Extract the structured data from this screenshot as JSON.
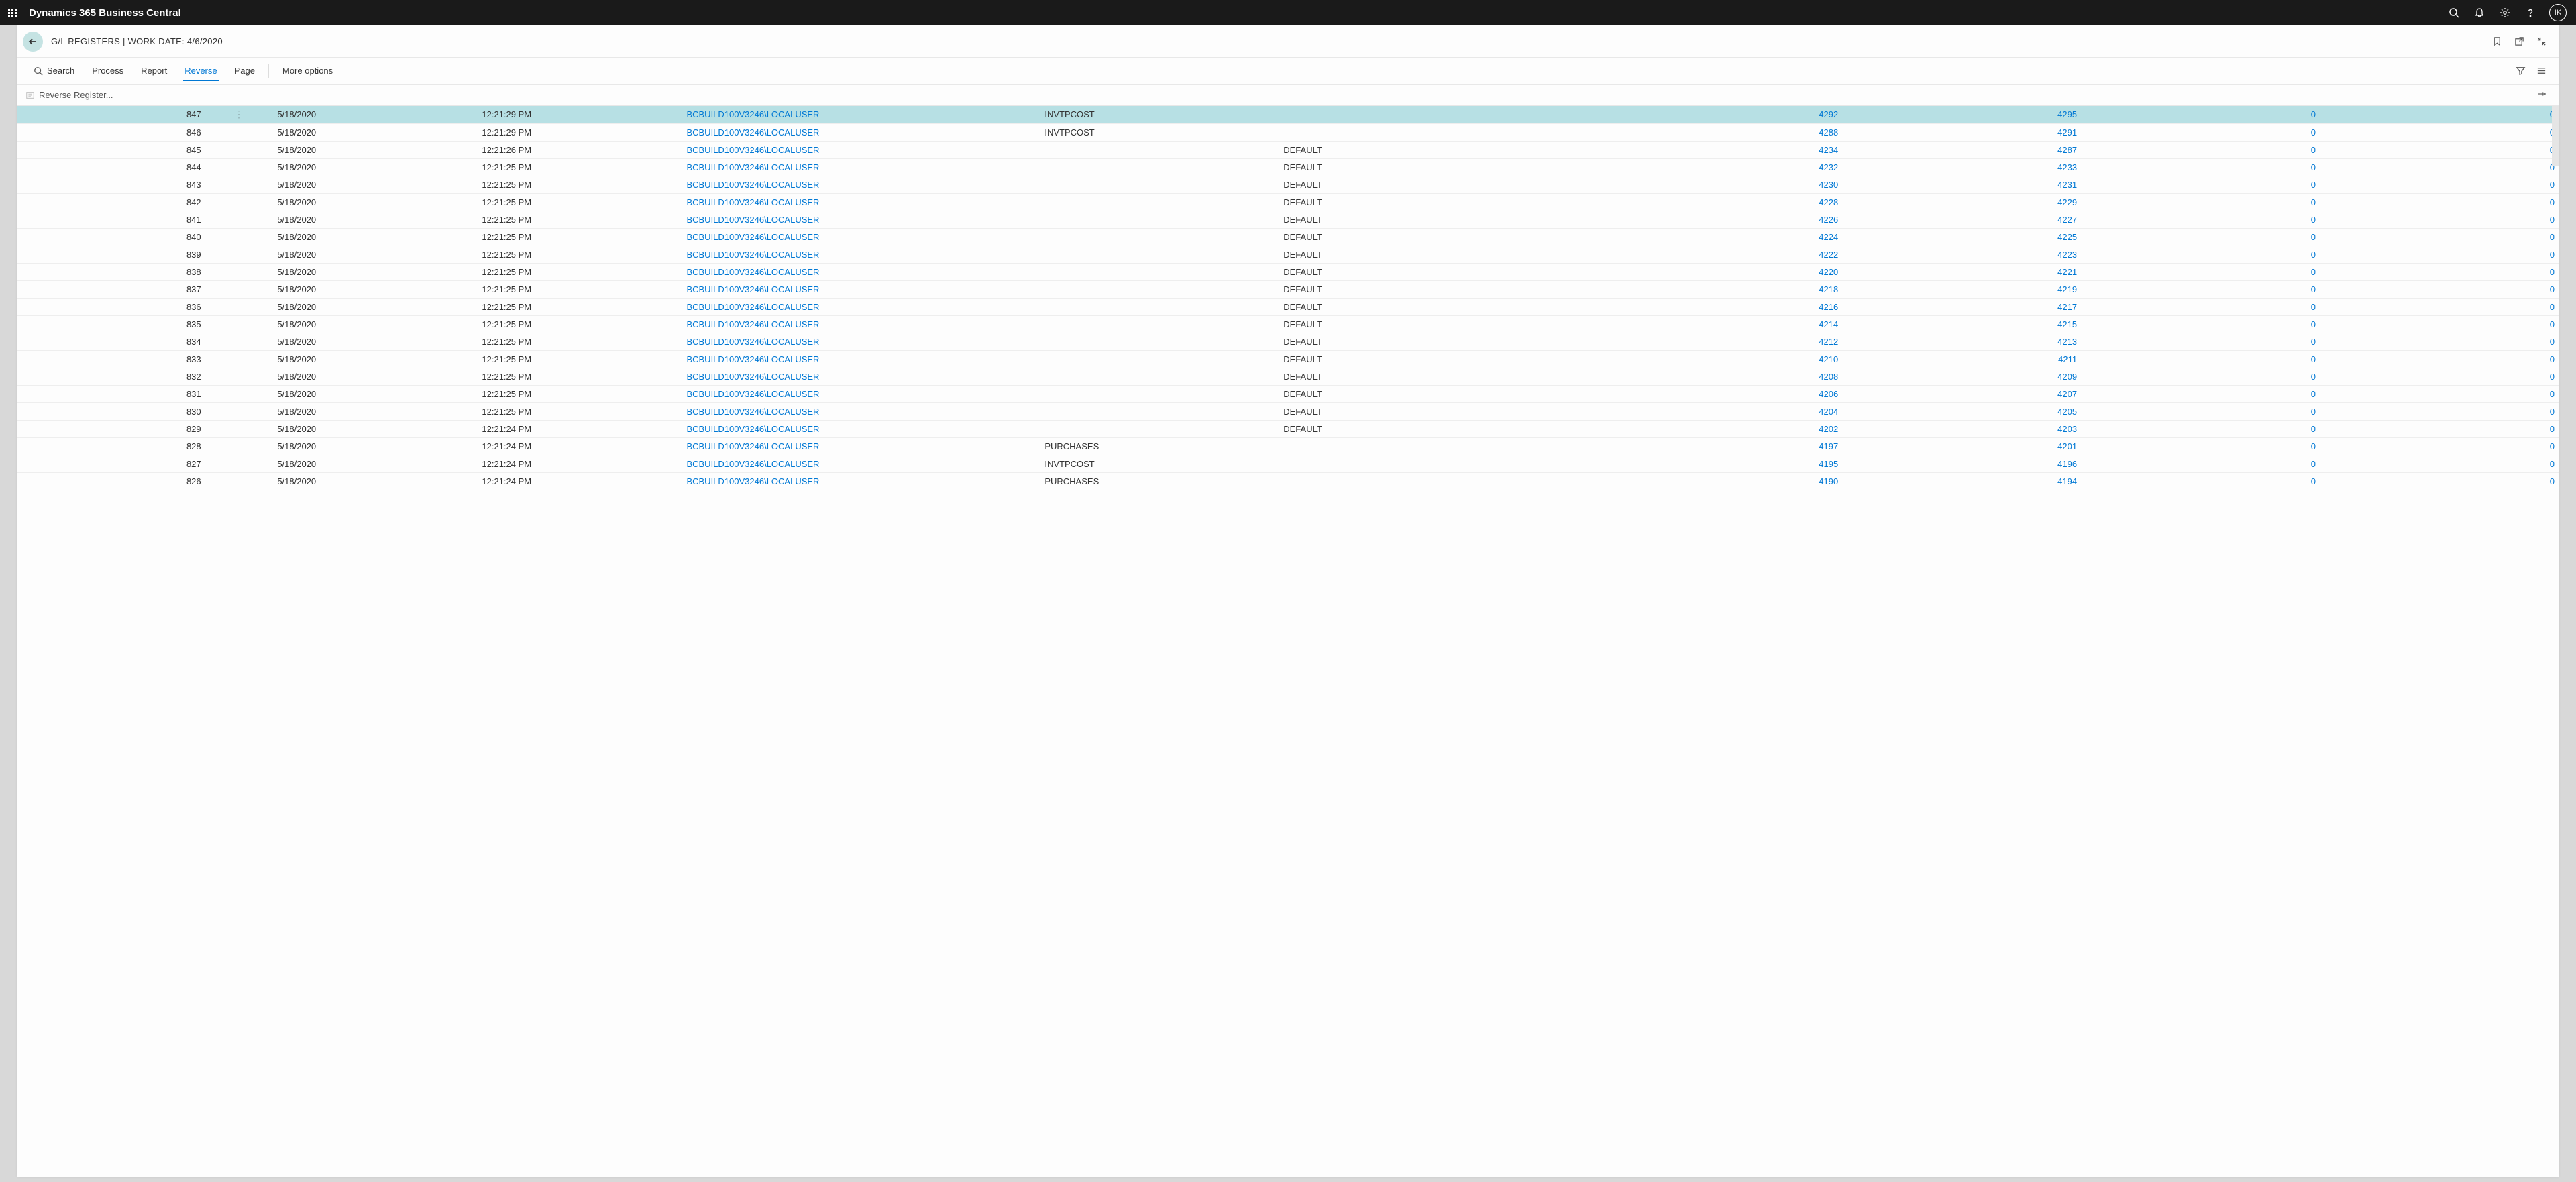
{
  "app": {
    "title": "Dynamics 365 Business Central",
    "avatar_initials": "IK"
  },
  "page": {
    "breadcrumb": "G/L REGISTERS | WORK DATE: 4/6/2020"
  },
  "actionbar": {
    "search": "Search",
    "process": "Process",
    "report": "Report",
    "reverse": "Reverse",
    "page": "Page",
    "more": "More options"
  },
  "subaction": {
    "reverse_register": "Reverse Register..."
  },
  "rows": [
    {
      "no": "847",
      "date": "5/18/2020",
      "time": "12:21:29 PM",
      "user": "BCBUILD100V3246\\LOCALUSER",
      "source": "INVTPCOST",
      "batch": "",
      "from": "4292",
      "to": "4295",
      "z1": "0",
      "z2": "0",
      "selected": true
    },
    {
      "no": "846",
      "date": "5/18/2020",
      "time": "12:21:29 PM",
      "user": "BCBUILD100V3246\\LOCALUSER",
      "source": "INVTPCOST",
      "batch": "",
      "from": "4288",
      "to": "4291",
      "z1": "0",
      "z2": "0"
    },
    {
      "no": "845",
      "date": "5/18/2020",
      "time": "12:21:26 PM",
      "user": "BCBUILD100V3246\\LOCALUSER",
      "source": "",
      "batch": "DEFAULT",
      "from": "4234",
      "to": "4287",
      "z1": "0",
      "z2": "0"
    },
    {
      "no": "844",
      "date": "5/18/2020",
      "time": "12:21:25 PM",
      "user": "BCBUILD100V3246\\LOCALUSER",
      "source": "",
      "batch": "DEFAULT",
      "from": "4232",
      "to": "4233",
      "z1": "0",
      "z2": "0"
    },
    {
      "no": "843",
      "date": "5/18/2020",
      "time": "12:21:25 PM",
      "user": "BCBUILD100V3246\\LOCALUSER",
      "source": "",
      "batch": "DEFAULT",
      "from": "4230",
      "to": "4231",
      "z1": "0",
      "z2": "0"
    },
    {
      "no": "842",
      "date": "5/18/2020",
      "time": "12:21:25 PM",
      "user": "BCBUILD100V3246\\LOCALUSER",
      "source": "",
      "batch": "DEFAULT",
      "from": "4228",
      "to": "4229",
      "z1": "0",
      "z2": "0"
    },
    {
      "no": "841",
      "date": "5/18/2020",
      "time": "12:21:25 PM",
      "user": "BCBUILD100V3246\\LOCALUSER",
      "source": "",
      "batch": "DEFAULT",
      "from": "4226",
      "to": "4227",
      "z1": "0",
      "z2": "0"
    },
    {
      "no": "840",
      "date": "5/18/2020",
      "time": "12:21:25 PM",
      "user": "BCBUILD100V3246\\LOCALUSER",
      "source": "",
      "batch": "DEFAULT",
      "from": "4224",
      "to": "4225",
      "z1": "0",
      "z2": "0"
    },
    {
      "no": "839",
      "date": "5/18/2020",
      "time": "12:21:25 PM",
      "user": "BCBUILD100V3246\\LOCALUSER",
      "source": "",
      "batch": "DEFAULT",
      "from": "4222",
      "to": "4223",
      "z1": "0",
      "z2": "0"
    },
    {
      "no": "838",
      "date": "5/18/2020",
      "time": "12:21:25 PM",
      "user": "BCBUILD100V3246\\LOCALUSER",
      "source": "",
      "batch": "DEFAULT",
      "from": "4220",
      "to": "4221",
      "z1": "0",
      "z2": "0"
    },
    {
      "no": "837",
      "date": "5/18/2020",
      "time": "12:21:25 PM",
      "user": "BCBUILD100V3246\\LOCALUSER",
      "source": "",
      "batch": "DEFAULT",
      "from": "4218",
      "to": "4219",
      "z1": "0",
      "z2": "0"
    },
    {
      "no": "836",
      "date": "5/18/2020",
      "time": "12:21:25 PM",
      "user": "BCBUILD100V3246\\LOCALUSER",
      "source": "",
      "batch": "DEFAULT",
      "from": "4216",
      "to": "4217",
      "z1": "0",
      "z2": "0"
    },
    {
      "no": "835",
      "date": "5/18/2020",
      "time": "12:21:25 PM",
      "user": "BCBUILD100V3246\\LOCALUSER",
      "source": "",
      "batch": "DEFAULT",
      "from": "4214",
      "to": "4215",
      "z1": "0",
      "z2": "0"
    },
    {
      "no": "834",
      "date": "5/18/2020",
      "time": "12:21:25 PM",
      "user": "BCBUILD100V3246\\LOCALUSER",
      "source": "",
      "batch": "DEFAULT",
      "from": "4212",
      "to": "4213",
      "z1": "0",
      "z2": "0"
    },
    {
      "no": "833",
      "date": "5/18/2020",
      "time": "12:21:25 PM",
      "user": "BCBUILD100V3246\\LOCALUSER",
      "source": "",
      "batch": "DEFAULT",
      "from": "4210",
      "to": "4211",
      "z1": "0",
      "z2": "0"
    },
    {
      "no": "832",
      "date": "5/18/2020",
      "time": "12:21:25 PM",
      "user": "BCBUILD100V3246\\LOCALUSER",
      "source": "",
      "batch": "DEFAULT",
      "from": "4208",
      "to": "4209",
      "z1": "0",
      "z2": "0"
    },
    {
      "no": "831",
      "date": "5/18/2020",
      "time": "12:21:25 PM",
      "user": "BCBUILD100V3246\\LOCALUSER",
      "source": "",
      "batch": "DEFAULT",
      "from": "4206",
      "to": "4207",
      "z1": "0",
      "z2": "0"
    },
    {
      "no": "830",
      "date": "5/18/2020",
      "time": "12:21:25 PM",
      "user": "BCBUILD100V3246\\LOCALUSER",
      "source": "",
      "batch": "DEFAULT",
      "from": "4204",
      "to": "4205",
      "z1": "0",
      "z2": "0"
    },
    {
      "no": "829",
      "date": "5/18/2020",
      "time": "12:21:24 PM",
      "user": "BCBUILD100V3246\\LOCALUSER",
      "source": "",
      "batch": "DEFAULT",
      "from": "4202",
      "to": "4203",
      "z1": "0",
      "z2": "0"
    },
    {
      "no": "828",
      "date": "5/18/2020",
      "time": "12:21:24 PM",
      "user": "BCBUILD100V3246\\LOCALUSER",
      "source": "PURCHASES",
      "batch": "",
      "from": "4197",
      "to": "4201",
      "z1": "0",
      "z2": "0"
    },
    {
      "no": "827",
      "date": "5/18/2020",
      "time": "12:21:24 PM",
      "user": "BCBUILD100V3246\\LOCALUSER",
      "source": "INVTPCOST",
      "batch": "",
      "from": "4195",
      "to": "4196",
      "z1": "0",
      "z2": "0"
    },
    {
      "no": "826",
      "date": "5/18/2020",
      "time": "12:21:24 PM",
      "user": "BCBUILD100V3246\\LOCALUSER",
      "source": "PURCHASES",
      "batch": "",
      "from": "4190",
      "to": "4194",
      "z1": "0",
      "z2": "0"
    }
  ]
}
